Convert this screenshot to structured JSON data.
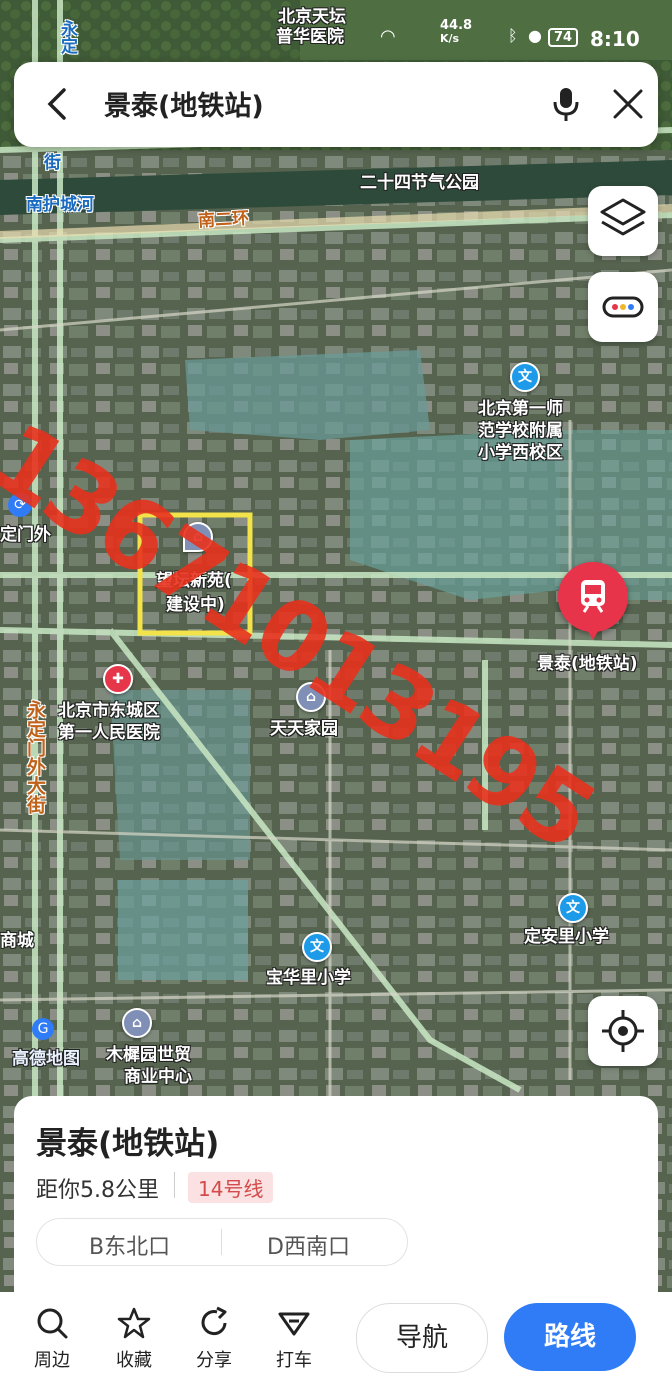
{
  "status": {
    "time": "8:10",
    "battery": "74",
    "net_speed": "44.8",
    "net_unit": "K/s"
  },
  "search": {
    "title": "景泰(地铁站)"
  },
  "map_labels": {
    "tiantan_hospital": "北京天坛",
    "tiantan_hospital2": "普华医院",
    "ershisi_park": "二十四节气公园",
    "nanhu_river": "南护城河",
    "south_2nd_ring": "南二环",
    "yongding_street": "永定门外大街",
    "jie": "街",
    "yongding_street_top": "永定",
    "dingmenwai": "定门外",
    "school1_l1": "北京第一师",
    "school1_l2": "范学校附属",
    "school1_l3": "小学西校区",
    "wangtan_l1": "望坛新苑(",
    "wangtan_l2": "建设中)",
    "hospital_l1": "北京市东城区",
    "hospital_l2": "第一人民医院",
    "tiantian": "天天家园",
    "jingtai": "景泰(地铁站)",
    "dinganli": "定安里小学",
    "baohuali": "宝华里小学",
    "shangcheng": "商城",
    "muyuan_l1": "木樨园世贸",
    "muyuan_l2": "商业中心",
    "gaode": "高德地图",
    "overlay_phone": "13671013195"
  },
  "place": {
    "name": "景泰(地铁站)",
    "distance": "距你5.8公里",
    "line": "14号线",
    "exits": [
      "B东北口",
      "D西南口"
    ]
  },
  "actions": {
    "nearby": "周边",
    "favorite": "收藏",
    "share": "分享",
    "taxi": "打车",
    "navigate": "导航",
    "route": "路线"
  },
  "colors": {
    "accent": "#2f7cf6",
    "subway_red": "#e8344a",
    "overlay_red": "#e8321e",
    "highlight_yellow": "#f2e34a"
  }
}
